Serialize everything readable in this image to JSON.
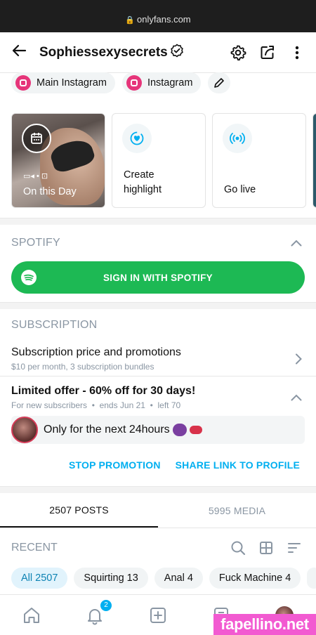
{
  "browser": {
    "url": "onlyfans.com"
  },
  "header": {
    "title": "Sophiessexysecrets"
  },
  "social_links": [
    {
      "label": "Main Instagram"
    },
    {
      "label": "Instagram"
    }
  ],
  "highlights": {
    "on_this_day": "On this Day",
    "create": "Create\nhighlight",
    "go_live": "Go live"
  },
  "spotify": {
    "heading": "SPOTIFY",
    "button": "SIGN IN WITH SPOTIFY"
  },
  "subscription": {
    "heading": "SUBSCRIPTION",
    "row_title": "Subscription price and promotions",
    "row_sub": "$10 per month, 3 subscription bundles"
  },
  "offer": {
    "title": "Limited offer - 60% off for 30 days!",
    "details": "For new subscribers  •  ends Jun 21  •  left 70",
    "message": "Only for the next 24hours",
    "stop": "STOP PROMOTION",
    "share": "SHARE LINK TO PROFILE"
  },
  "tabs": [
    {
      "label": "2507 POSTS"
    },
    {
      "label": "5995 MEDIA"
    }
  ],
  "recent": {
    "heading": "RECENT"
  },
  "chips": [
    {
      "label": "All 2507"
    },
    {
      "label": "Squirting 13"
    },
    {
      "label": "Anal 4"
    },
    {
      "label": "Fuck Machine 4"
    }
  ],
  "nav": {
    "notifications_badge": "2"
  },
  "watermark": "fapellino.net",
  "colors": {
    "accent": "#00aff0",
    "spotify": "#1db954",
    "instagram": "#e6357a",
    "watermark": "#f25ad1"
  }
}
